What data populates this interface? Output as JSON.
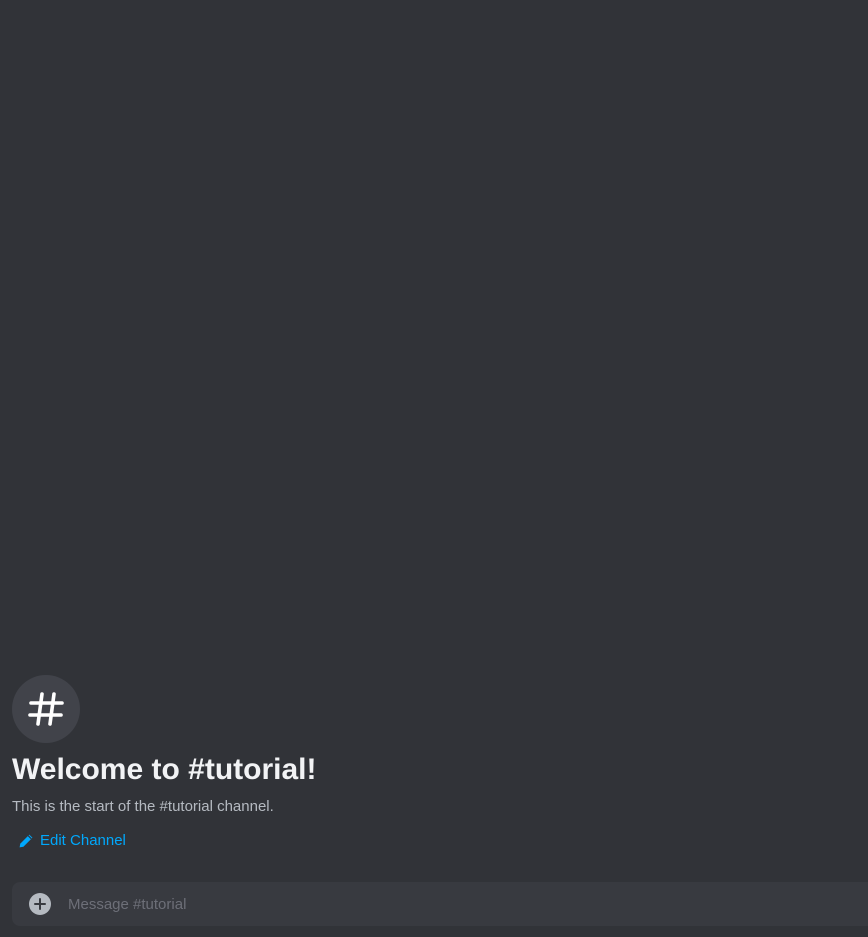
{
  "channel": {
    "name": "tutorial",
    "icon": "hash-icon"
  },
  "welcome": {
    "title": "Welcome to #tutorial!",
    "subtitle": "This is the start of the #tutorial channel.",
    "edit_label": "Edit Channel",
    "edit_icon": "pencil-icon"
  },
  "composer": {
    "placeholder": "Message #tutorial",
    "attach_icon": "plus-circle-icon"
  },
  "colors": {
    "background": "#313338",
    "link": "#00a8fc",
    "composer_bg": "#383a40"
  }
}
